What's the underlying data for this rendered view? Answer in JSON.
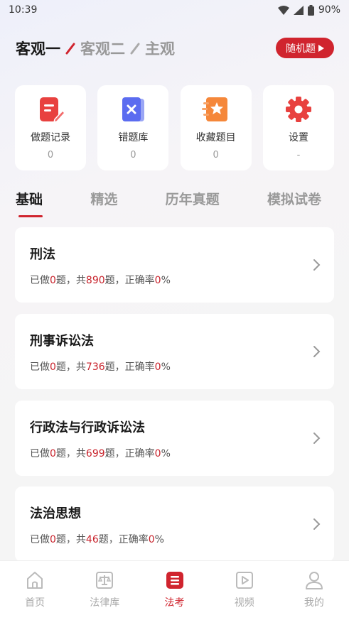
{
  "status": {
    "time": "10:39",
    "battery": "90%"
  },
  "top_tabs": [
    {
      "label": "客观一",
      "active": true
    },
    {
      "label": "客观二",
      "active": false
    },
    {
      "label": "主观",
      "active": false
    }
  ],
  "random_button": {
    "label": "随机题"
  },
  "quick_cards": [
    {
      "label": "做题记录",
      "value": "0",
      "icon": "record-icon"
    },
    {
      "label": "错题库",
      "value": "0",
      "icon": "wrong-questions-icon"
    },
    {
      "label": "收藏题目",
      "value": "0",
      "icon": "favorites-icon"
    },
    {
      "label": "设置",
      "value": "-",
      "icon": "settings-gear-icon"
    }
  ],
  "category_tabs": [
    {
      "label": "基础",
      "active": true
    },
    {
      "label": "精选",
      "active": false
    },
    {
      "label": "历年真题",
      "active": false
    },
    {
      "label": "模拟试卷",
      "active": false
    }
  ],
  "stats_text": {
    "done_prefix": "已做",
    "unit_total": "题，共",
    "unit_rate": "题，正确率",
    "percent": "%"
  },
  "subjects": [
    {
      "title": "刑法",
      "done": "0",
      "total": "890",
      "rate": "0"
    },
    {
      "title": "刑事诉讼法",
      "done": "0",
      "total": "736",
      "rate": "0"
    },
    {
      "title": "行政法与行政诉讼法",
      "done": "0",
      "total": "699",
      "rate": "0"
    },
    {
      "title": "法治思想",
      "done": "0",
      "total": "46",
      "rate": "0"
    }
  ],
  "bottom_nav": [
    {
      "label": "首页",
      "icon": "home-icon",
      "active": false
    },
    {
      "label": "法律库",
      "icon": "law-library-icon",
      "active": false
    },
    {
      "label": "法考",
      "icon": "exam-icon",
      "active": true
    },
    {
      "label": "视频",
      "icon": "video-icon",
      "active": false
    },
    {
      "label": "我的",
      "icon": "profile-icon",
      "active": false
    }
  ],
  "colors": {
    "accent": "#d0242e",
    "number": "#c8232c"
  }
}
